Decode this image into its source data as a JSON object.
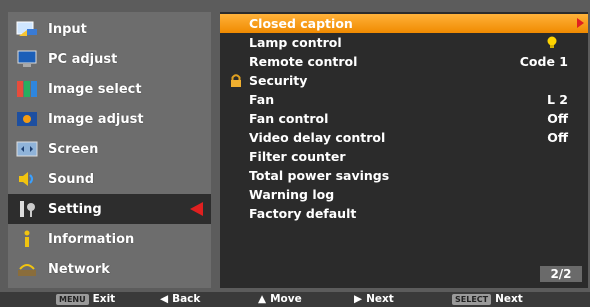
{
  "sidebar": {
    "items": [
      {
        "label": "Input",
        "icon": "input-icon"
      },
      {
        "label": "PC adjust",
        "icon": "pc-adjust-icon"
      },
      {
        "label": "Image select",
        "icon": "image-select-icon"
      },
      {
        "label": "Image adjust",
        "icon": "image-adjust-icon"
      },
      {
        "label": "Screen",
        "icon": "screen-icon"
      },
      {
        "label": "Sound",
        "icon": "sound-icon"
      },
      {
        "label": "Setting",
        "icon": "setting-icon",
        "active": true
      },
      {
        "label": "Information",
        "icon": "information-icon"
      },
      {
        "label": "Network",
        "icon": "network-icon"
      }
    ]
  },
  "menu": {
    "rows": [
      {
        "label": "Closed caption",
        "value": "",
        "selected": true
      },
      {
        "label": "Lamp control",
        "value": "",
        "icon": "bulb-icon"
      },
      {
        "label": "Remote control",
        "value": "Code 1"
      },
      {
        "label": "Security",
        "value": "",
        "icon": "lock-icon"
      },
      {
        "label": "Fan",
        "value": "L 2"
      },
      {
        "label": "Fan control",
        "value": "Off"
      },
      {
        "label": "Video delay control",
        "value": "Off"
      },
      {
        "label": "Filter counter",
        "value": ""
      },
      {
        "label": "Total power savings",
        "value": ""
      },
      {
        "label": "Warning log",
        "value": ""
      },
      {
        "label": "Factory default",
        "value": ""
      }
    ],
    "page_indicator": "2/2"
  },
  "footer": {
    "exit_key": "MENU",
    "exit_label": "Exit",
    "back_label": "Back",
    "move_label": "Move",
    "next_label": "Next",
    "select_key": "SELECT",
    "select_next_label": "Next"
  },
  "colors": {
    "selection_orange": "#f5a020",
    "arrow_red": "#e02020",
    "active_bg": "#2d2d2d"
  }
}
